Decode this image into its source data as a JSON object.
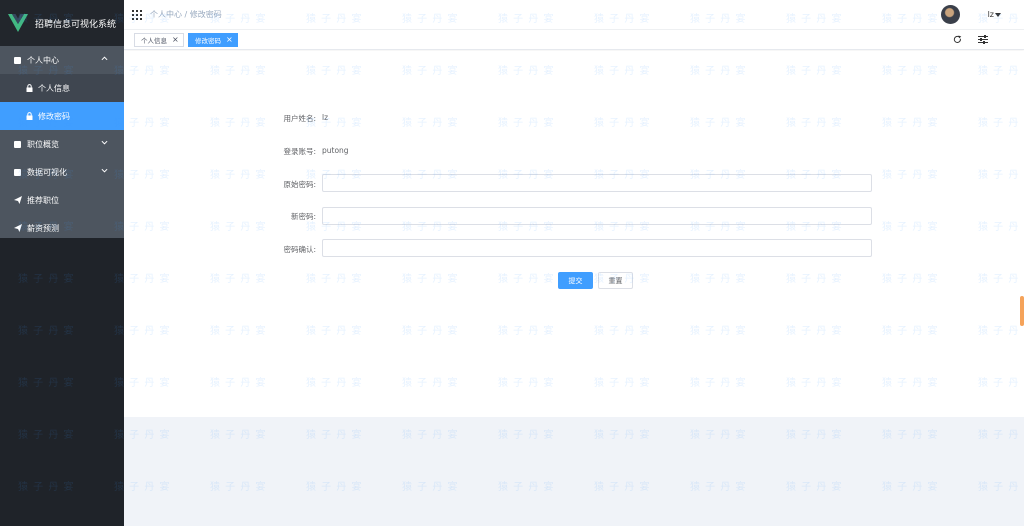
{
  "app": {
    "title": "招聘信息可视化系统"
  },
  "sidebar": {
    "items": [
      {
        "label": "个人中心",
        "icon": "square-icon",
        "expanded": true,
        "children": [
          {
            "label": "个人信息",
            "icon": "lock-icon"
          },
          {
            "label": "修改密码",
            "icon": "lock-icon",
            "active": true
          }
        ]
      },
      {
        "label": "职位概览",
        "icon": "square-icon"
      },
      {
        "label": "数据可视化",
        "icon": "square-icon"
      },
      {
        "label": "推荐职位",
        "icon": "plane-icon"
      },
      {
        "label": "薪资预测",
        "icon": "plane-icon"
      }
    ]
  },
  "header": {
    "breadcrumb": "个人中心 / 修改密码",
    "user": "lz"
  },
  "tags": [
    {
      "label": "个人信息",
      "active": false
    },
    {
      "label": "修改密码",
      "active": true
    }
  ],
  "form": {
    "username_label": "用户姓名:",
    "username_value": "lz",
    "account_label": "登录账号:",
    "account_value": "putong",
    "old_password_label": "原始密码:",
    "old_password_value": "",
    "new_password_label": "新密码:",
    "new_password_value": "",
    "confirm_label": "密码确认:",
    "confirm_value": "",
    "submit_label": "提交",
    "reset_label": "重置"
  },
  "watermark": {
    "text": "猿 子 丹 宴"
  },
  "colors": {
    "accent": "#409eff",
    "sidebar_bg": "#1f2329",
    "sidebar_menu_bg": "#4d555f",
    "logo_green": "#42b883"
  }
}
